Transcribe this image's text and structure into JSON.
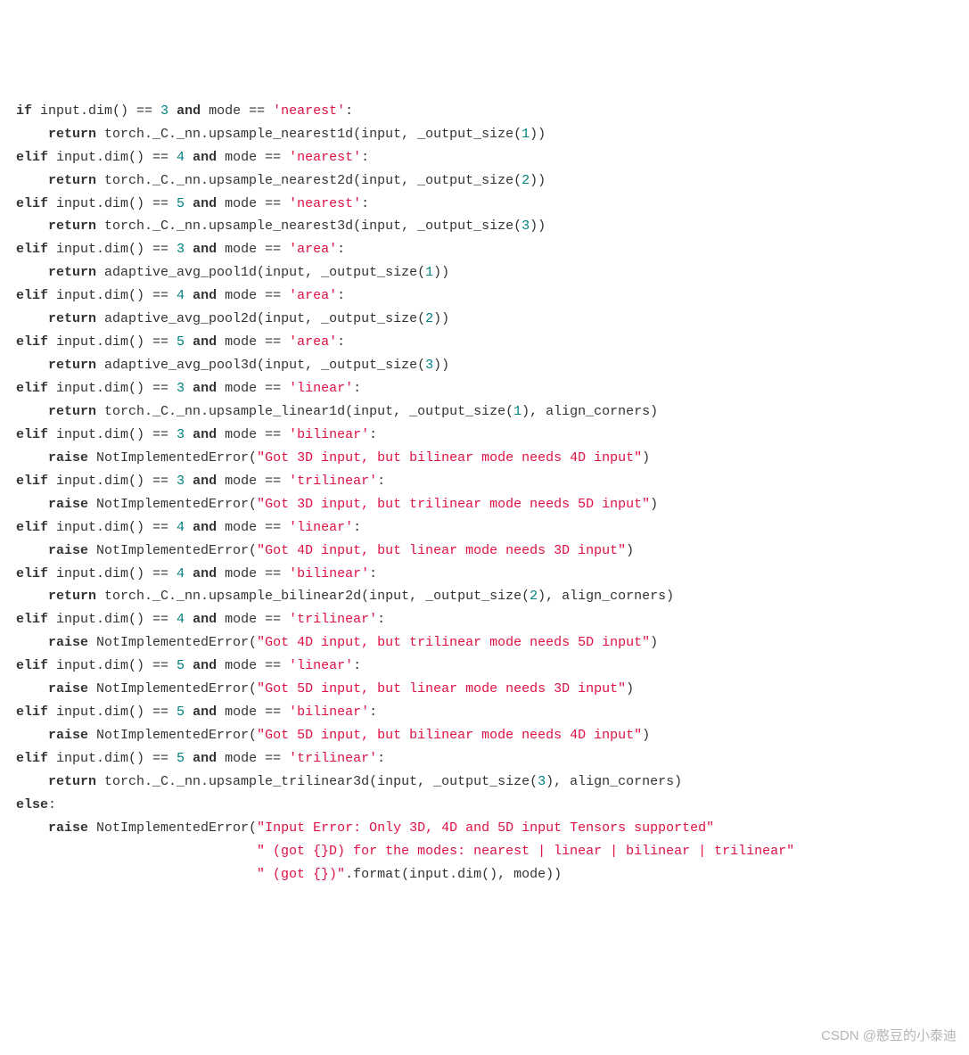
{
  "code": {
    "kw_if": "if",
    "kw_elif": "elif",
    "kw_else": "else",
    "kw_and": "and",
    "kw_return": "return",
    "kw_raise": "raise",
    "input_dim_eq": " input.dim() == ",
    "mode_eq": " mode == ",
    "colon": ":",
    "n3": "3",
    "n4": "4",
    "n5": "5",
    "n1": "1",
    "n2": "2",
    "s_nearest": "'nearest'",
    "s_area": "'area'",
    "s_linear": "'linear'",
    "s_bilinear": "'bilinear'",
    "s_trilinear": "'trilinear'",
    "call_nearest1d_a": " torch._C._nn.upsample_nearest1d(input, _output_size(",
    "call_nearest2d_a": " torch._C._nn.upsample_nearest2d(input, _output_size(",
    "call_nearest3d_a": " torch._C._nn.upsample_nearest3d(input, _output_size(",
    "call_pool1d_a": " adaptive_avg_pool1d(input, _output_size(",
    "call_pool2d_a": " adaptive_avg_pool2d(input, _output_size(",
    "call_pool3d_a": " adaptive_avg_pool3d(input, _output_size(",
    "call_linear1d_a": " torch._C._nn.upsample_linear1d(input, _output_size(",
    "call_bilinear2d_a": " torch._C._nn.upsample_bilinear2d(input, _output_size(",
    "call_trilinear3d_a": " torch._C._nn.upsample_trilinear3d(input, _output_size(",
    "close_pp": "))",
    "close_align": "), align_corners)",
    "nie_open": " NotImplementedError(",
    "close_paren": ")",
    "err_3d_bil": "\"Got 3D input, but bilinear mode needs 4D input\"",
    "err_3d_tri": "\"Got 3D input, but trilinear mode needs 5D input\"",
    "err_4d_lin": "\"Got 4D input, but linear mode needs 3D input\"",
    "err_4d_tri": "\"Got 4D input, but trilinear mode needs 5D input\"",
    "err_5d_lin": "\"Got 5D input, but linear mode needs 3D input\"",
    "err_5d_bil": "\"Got 5D input, but bilinear mode needs 4D input\"",
    "err_main1": "\"Input Error: Only 3D, 4D and 5D input Tensors supported\"",
    "err_main2": "\" (got {}D) for the modes: nearest | linear | bilinear | trilinear\"",
    "err_main3": "\" (got {})\"",
    "format_tail": ".format(input.dim(), mode))",
    "indent1": "    ",
    "indent_cont": "                              "
  },
  "watermark": "CSDN @憨豆的小泰迪"
}
